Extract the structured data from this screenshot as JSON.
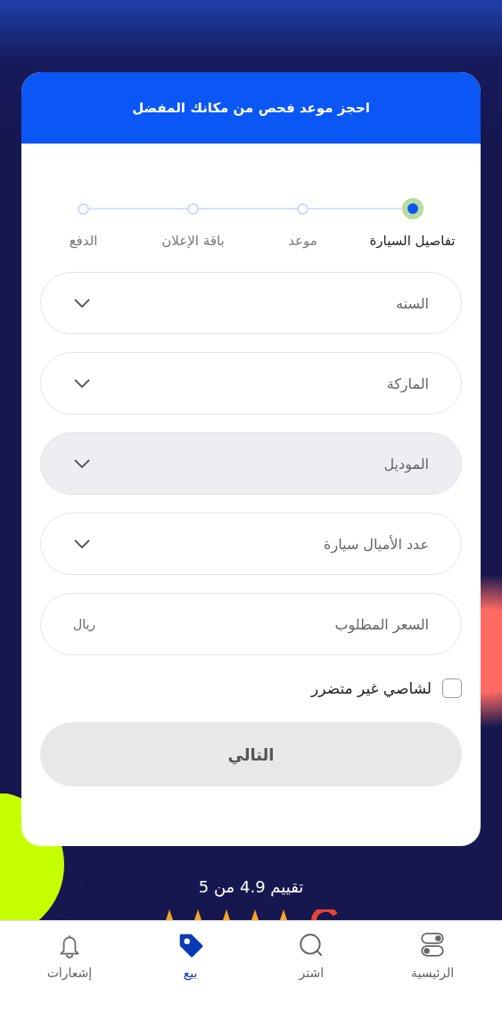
{
  "card": {
    "title": "احجز موعد فحص من مكانك المفضل"
  },
  "steps": [
    {
      "label": "تفاصيل السيارة",
      "selected": true
    },
    {
      "label": "موعد",
      "selected": false
    },
    {
      "label": "باقة الإعلان",
      "selected": false
    },
    {
      "label": "الدفع",
      "selected": false
    }
  ],
  "fields": [
    {
      "kind": "select",
      "placeholder": "السنه",
      "disabled": false
    },
    {
      "kind": "select",
      "placeholder": "الماركة",
      "disabled": false
    },
    {
      "kind": "select",
      "placeholder": "الموديل",
      "disabled": true
    },
    {
      "kind": "select",
      "placeholder": "عدد الأميال سيارة",
      "disabled": false
    },
    {
      "kind": "input",
      "placeholder": "السعر المطلوب",
      "suffix": "ريال",
      "disabled": false
    }
  ],
  "checkbox": {
    "label": "لشاصي غير متضرر",
    "checked": false
  },
  "next_button": {
    "label": "التالي",
    "disabled": true
  },
  "rating": {
    "text": "تقييم 4.9 من 5"
  },
  "nav": [
    {
      "label": "الرئيسية",
      "kind": "toggles",
      "selected": false
    },
    {
      "label": "اشتر",
      "kind": "search",
      "selected": false
    },
    {
      "label": "بيع",
      "kind": "tag",
      "selected": true
    },
    {
      "label": "إشعارات",
      "kind": "bell",
      "selected": false
    }
  ]
}
